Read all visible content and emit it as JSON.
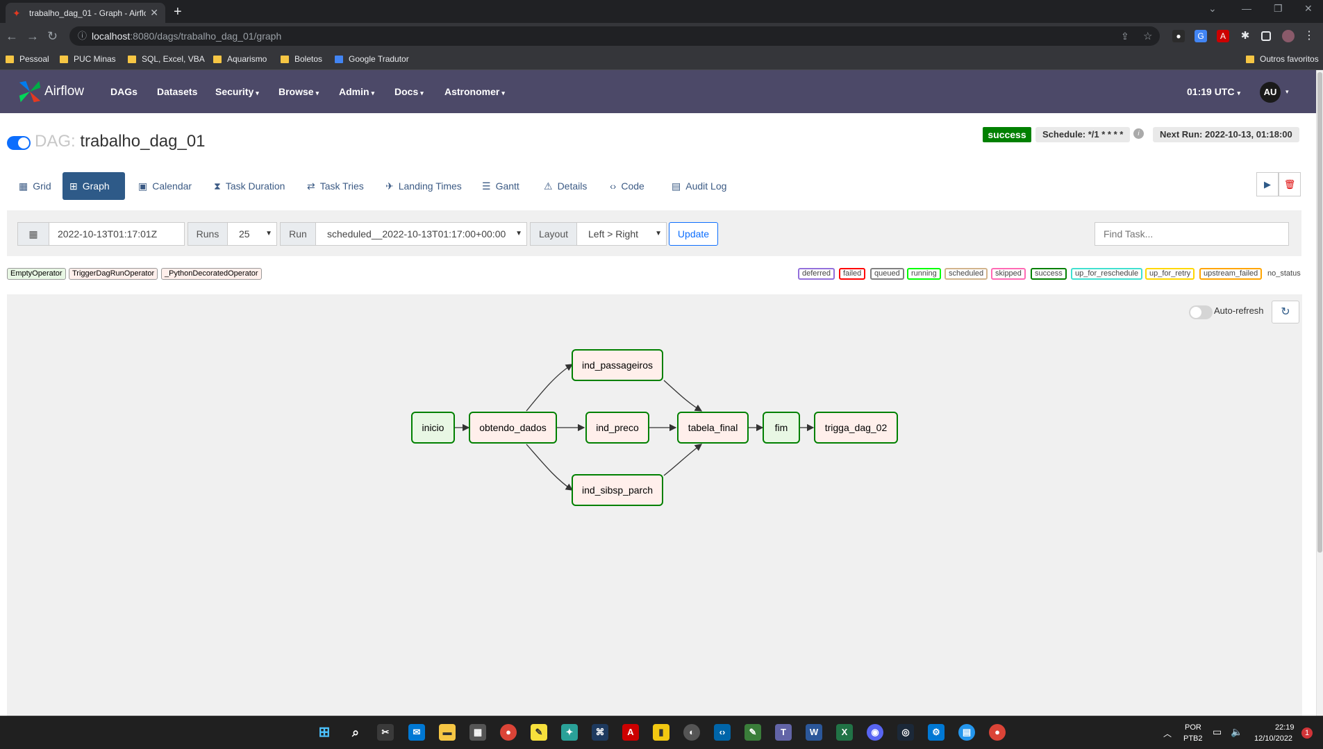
{
  "browser": {
    "tab_title": "trabalho_dag_01 - Graph - Airflo",
    "url_host": "localhost",
    "url_path": ":8080/dags/trabalho_dag_01/graph",
    "bookmarks": [
      "Pessoal",
      "PUC Minas",
      "SQL, Excel, VBA",
      "Aquarismo",
      "Boletos",
      "Google Tradutor"
    ],
    "other_bookmarks": "Outros favoritos"
  },
  "navbar": {
    "brand": "Airflow",
    "items": [
      "DAGs",
      "Datasets",
      "Security",
      "Browse",
      "Admin",
      "Docs",
      "Astronomer"
    ],
    "time": "01:19 UTC",
    "user_initials": "AU"
  },
  "dag": {
    "prefix": "DAG:",
    "id": "trabalho_dag_01",
    "state": "success",
    "schedule": "Schedule: */1 * * * *",
    "next_run": "Next Run: 2022-10-13, 01:18:00"
  },
  "view_tabs": [
    "Grid",
    "Graph",
    "Calendar",
    "Task Duration",
    "Task Tries",
    "Landing Times",
    "Gantt",
    "Details",
    "Code",
    "Audit Log"
  ],
  "active_tab": "Graph",
  "controls": {
    "base_date": "2022-10-13T01:17:01Z",
    "runs_label": "Runs",
    "runs_value": "25",
    "run_label": "Run",
    "run_value": "scheduled__2022-10-13T01:17:00+00:00",
    "layout_label": "Layout",
    "layout_value": "Left > Right",
    "update_label": "Update",
    "find_task_placeholder": "Find Task..."
  },
  "operators": [
    {
      "name": "EmptyOperator",
      "color": "#e8f7e4"
    },
    {
      "name": "TriggerDagRunOperator",
      "color": "#ffefeb"
    },
    {
      "name": "_PythonDecoratedOperator",
      "color": "#ffefeb"
    }
  ],
  "states": [
    {
      "name": "deferred",
      "color": "#9370db"
    },
    {
      "name": "failed",
      "color": "#ff0000"
    },
    {
      "name": "queued",
      "color": "#808080"
    },
    {
      "name": "running",
      "color": "#00ff00"
    },
    {
      "name": "scheduled",
      "color": "#d2b48c"
    },
    {
      "name": "skipped",
      "color": "#ff69b4"
    },
    {
      "name": "success",
      "color": "#008000"
    },
    {
      "name": "up_for_reschedule",
      "color": "#40e0d0"
    },
    {
      "name": "up_for_retry",
      "color": "#ffd700"
    },
    {
      "name": "upstream_failed",
      "color": "#ffa500"
    },
    {
      "name": "no_status",
      "color": "#ffffff"
    }
  ],
  "graph": {
    "auto_refresh_label": "Auto-refresh",
    "tasks": {
      "inicio": "inicio",
      "obtendo_dados": "obtendo_dados",
      "ind_passageiros": "ind_passageiros",
      "ind_preco": "ind_preco",
      "ind_sibsp_parch": "ind_sibsp_parch",
      "tabela_final": "tabela_final",
      "fim": "fim",
      "trigga_dag_02": "trigga_dag_02"
    }
  },
  "taskbar": {
    "lang": "POR",
    "layout": "PTB2",
    "time": "22:19",
    "date": "12/10/2022",
    "notifications": "1"
  }
}
